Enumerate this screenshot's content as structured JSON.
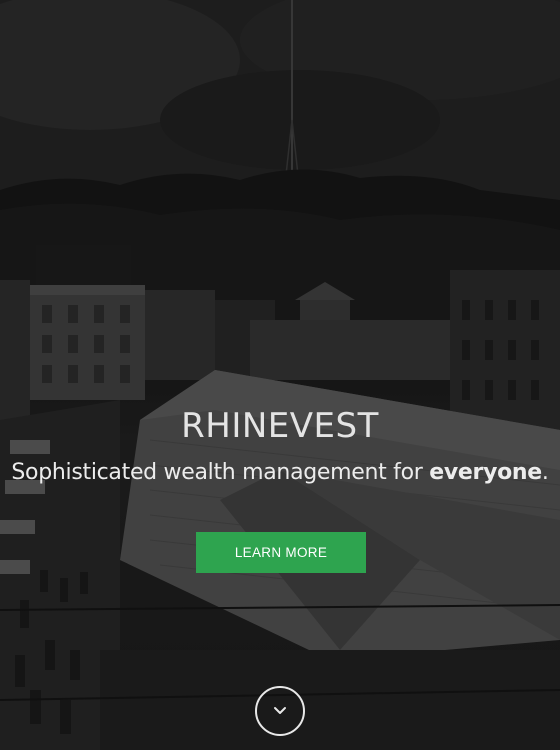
{
  "hero": {
    "brand": "RHINEVEST",
    "tagline_prefix": "Sophisticated wealth management for ",
    "tagline_emphasis": "everyone",
    "tagline_suffix": ".",
    "cta_label": "LEARN MORE",
    "scroll_icon": "chevron-down-icon",
    "background_image": "grayscale-cityscape-market-hillside-tower"
  },
  "colors": {
    "cta_background": "#2ea44f",
    "text": "#ececec",
    "overlay": "rgba(0,0,0,0.38)"
  }
}
